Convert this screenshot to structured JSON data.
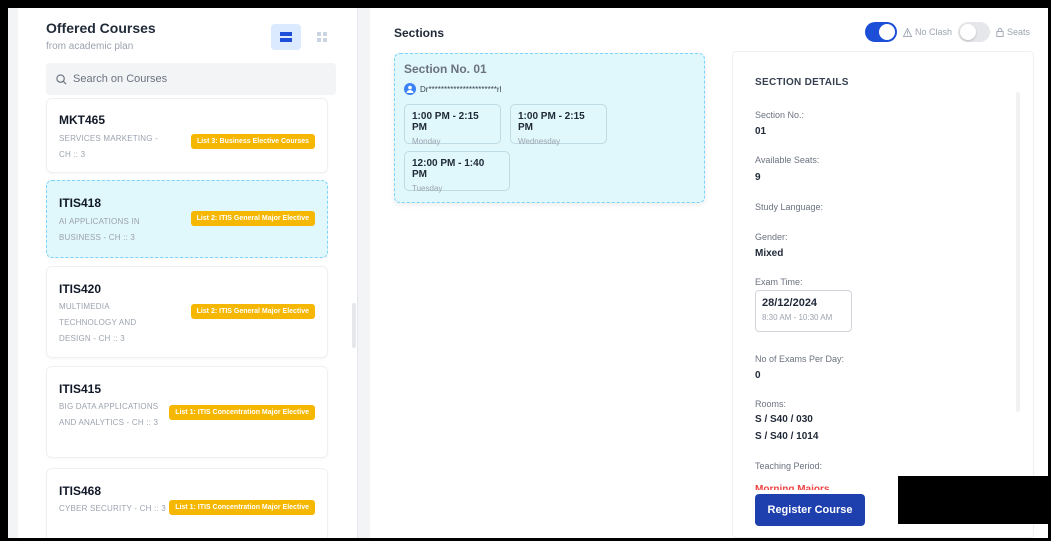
{
  "left_panel": {
    "title": "Offered Courses",
    "subtitle": "from academic plan",
    "search_placeholder": "Search on Courses",
    "courses": [
      {
        "code": "MKT465",
        "name": "SERVICES MARKETING - CH :: 3",
        "tag": "List 3: Business Elective Courses",
        "selected": false
      },
      {
        "code": "ITIS418",
        "name": "AI APPLICATIONS IN BUSINESS - CH :: 3",
        "tag": "List 2: ITIS General Major Elective",
        "selected": true
      },
      {
        "code": "ITIS420",
        "name": "MULTIMEDIA TECHNOLOGY AND DESIGN - CH :: 3",
        "tag": "List 2: ITIS General Major Elective",
        "selected": false
      },
      {
        "code": "ITIS415",
        "name": "BIG DATA APPLICATIONS AND ANALYTICS - CH :: 3",
        "tag": "List 1: ITIS Concentration Major Elective",
        "selected": false
      },
      {
        "code": "ITIS468",
        "name": "CYBER SECURITY - CH :: 3",
        "tag": "List 1: ITIS Concentration Major Elective",
        "selected": false
      }
    ]
  },
  "sections_panel": {
    "title": "Sections",
    "toggle_no_clash": "No Clash",
    "toggle_seats": "Seats",
    "section": {
      "number_label": "Section No. 01",
      "instructor": "Dr**********************rl",
      "slots": [
        {
          "time": "1:00 PM - 2:15 PM",
          "day": "Monday"
        },
        {
          "time": "1:00 PM - 2:15 PM",
          "day": "Wednesday"
        },
        {
          "time": "12:00 PM - 1:40 PM",
          "day": "Tuesday"
        }
      ]
    }
  },
  "details": {
    "title": "SECTION DETAILS",
    "section_no_label": "Section No.:",
    "section_no_value": "01",
    "seats_label": "Available Seats:",
    "seats_value": "9",
    "language_label": "Study Language:",
    "gender_label": "Gender:",
    "gender_value": "Mixed",
    "exam_label": "Exam Time:",
    "exam_date": "28/12/2024",
    "exam_time": "8:30 AM - 10:30 AM",
    "exams_per_day_label": "No of Exams Per Day:",
    "exams_per_day_value": "0",
    "rooms_label": "Rooms:",
    "rooms": [
      "S / S40 / 030",
      "S / S40 / 1014"
    ],
    "teaching_label": "Teaching Period:",
    "teaching_value": "Morning Majors",
    "register_button": "Register Course"
  },
  "colors": {
    "accent": "#1e40af",
    "tag": "#f5b700",
    "selected_bg": "#e0f7fb"
  }
}
